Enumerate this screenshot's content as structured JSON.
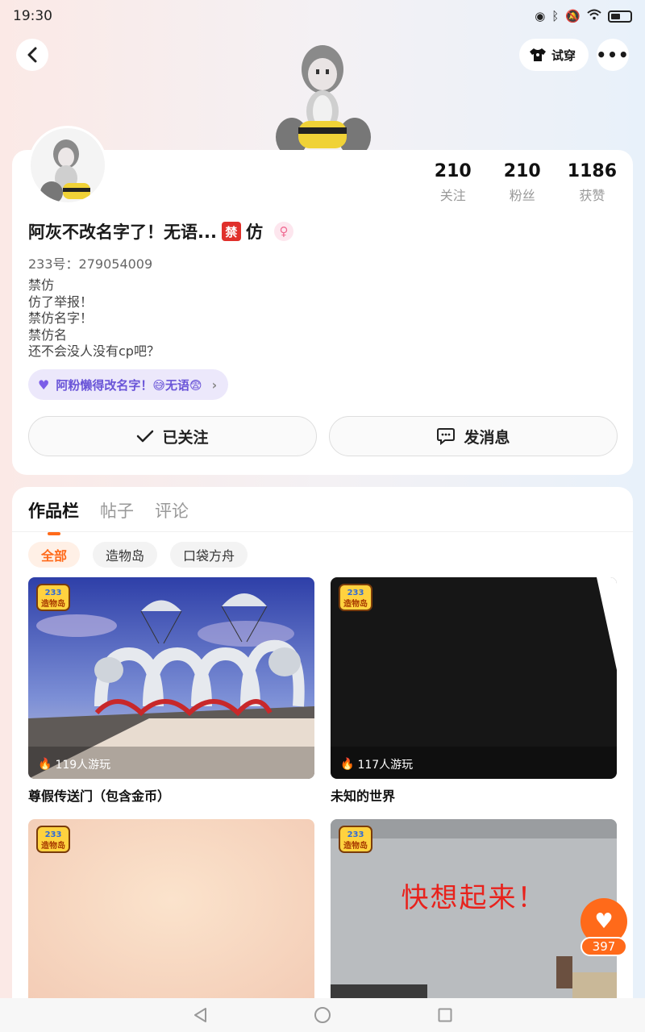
{
  "status_bar": {
    "time": "19:30"
  },
  "top_nav": {
    "try_on_label": "试穿",
    "more_label": "•••"
  },
  "profile": {
    "stats": [
      {
        "value": "210",
        "label": "关注"
      },
      {
        "value": "210",
        "label": "粉丝"
      },
      {
        "value": "1186",
        "label": "获赞"
      }
    ],
    "nickname": "阿灰不改名字了！无语...",
    "ban_badge": "禁",
    "nickname_suffix": "仿",
    "uid": "233号：279054009",
    "bio_lines": [
      "禁仿",
      "仿了举报！",
      "禁仿名字！",
      "禁仿名",
      "还不会没人没有cp吧？"
    ],
    "fan_chip": "阿粉懒得改名字！😅无语😨",
    "follow_label": "已关注",
    "message_label": "发消息"
  },
  "works": {
    "tabs": [
      "作品栏",
      "帖子",
      "评论"
    ],
    "filters": [
      "全部",
      "造物岛",
      "口袋方舟"
    ],
    "logo_text": {
      "top": "233",
      "bottom": "造物岛"
    },
    "cards": [
      {
        "title": "尊假传送门（包含金币）",
        "plays": "119人游玩"
      },
      {
        "title": "未知的世界",
        "plays": "117人游玩"
      },
      {
        "title": "",
        "plays": ""
      },
      {
        "title": "",
        "plays": "",
        "overlay_text": "快想起来！"
      }
    ]
  },
  "like_float": {
    "count": "397"
  },
  "colors": {
    "accent": "#ff6a1a",
    "ban_red": "#e0302b",
    "chip_purple": "#6a55d8"
  }
}
